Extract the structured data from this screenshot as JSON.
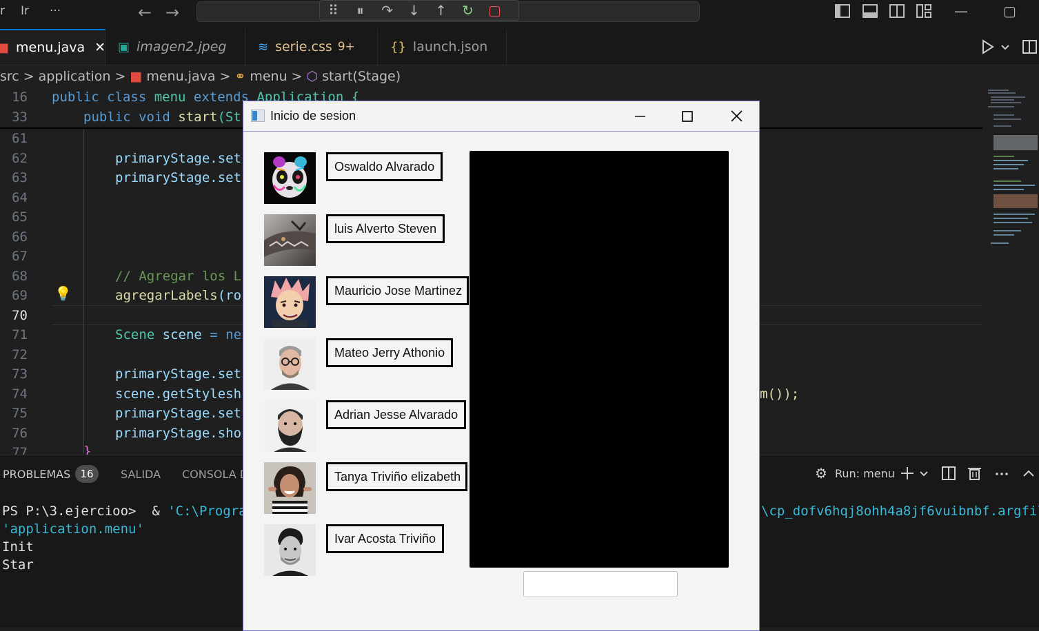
{
  "titlebar": {
    "menu_left_1": "r",
    "menu_left_2": "Ir",
    "more": "···",
    "back": "←",
    "forward": "→"
  },
  "debug_toolbar": {
    "grip": "⠿",
    "pause": "⏸",
    "step_over": "↷",
    "step_into": "↓",
    "step_out": "↑",
    "restart": "↻",
    "stop": "▢",
    "dropdown": "⌄"
  },
  "window_controls": {
    "minimize": "—",
    "maximize": "▢"
  },
  "tabs": [
    {
      "label": "menu.java",
      "icon": "java-icon",
      "close": "✕",
      "active": true
    },
    {
      "label": "imagen2.jpeg",
      "icon": "image-icon"
    },
    {
      "label": "serie.css",
      "badge": "9+",
      "icon": "css-icon"
    },
    {
      "label": "launch.json",
      "icon": "json-icon",
      "icon_text": "{}"
    }
  ],
  "breadcrumb": {
    "src": "src",
    "application": "application",
    "file": "menu.java",
    "class": "menu",
    "method": "start(Stage)",
    "sep": ">"
  },
  "editor": {
    "line_numbers": [
      "16",
      "33",
      "61",
      "62",
      "63",
      "64",
      "65",
      "66",
      "67",
      "68",
      "69",
      "70",
      "71",
      "72",
      "73",
      "74",
      "75",
      "76",
      "77"
    ],
    "lines": {
      "l16_a": "public class ",
      "l16_b": "menu ",
      "l16_c": "extends ",
      "l16_d": "Application {",
      "l33_a": "public void ",
      "l33_b": "start",
      "l33_c": "(St",
      "l62": "primaryStage.set",
      "l63": "primaryStage.set",
      "l68": "// Agregar los L",
      "l69_a": "agregarLabels",
      "l69_b": "(ro",
      "l71_a": "Scene ",
      "l71_b": "scene ",
      "l71_c": "= ne",
      "l73": "primaryStage.set",
      "l74": "scene.getStylesh",
      "l74_tail": "m());",
      "l75": "primaryStage.set",
      "l76": "primaryStage.sho",
      "l77": "}"
    }
  },
  "panel": {
    "tabs": {
      "problems": "PROBLEMAS",
      "problems_count": "16",
      "output": "SALIDA",
      "console": "CONSOLA D"
    },
    "run_label": "Run: menu",
    "terminal": {
      "prompt": "PS P:\\3.ejercioo>  & ",
      "path": "'C:\\Program",
      "path_tail": "\\cp_dofv6hqj8ohh4a8jf6vuibnbf.argfile",
      "arg": "'application.menu'",
      "out1": "Init",
      "out2": "Star"
    }
  },
  "dialog": {
    "title": "Inicio de sesion",
    "people": [
      {
        "name": "Oswaldo Alvarado",
        "image": "panda-art"
      },
      {
        "name": "luis Alverto Steven",
        "image": "dragon"
      },
      {
        "name": "Mauricio Jose Martinez",
        "image": "anime-character"
      },
      {
        "name": "Mateo Jerry Athonio",
        "image": "man-glasses"
      },
      {
        "name": "Adrian Jesse Alvarado",
        "image": "bearded-man"
      },
      {
        "name": "Tanya Triviño elizabeth",
        "image": "woman-smiling"
      },
      {
        "name": "Ivar Acosta Triviño",
        "image": "man-portrait"
      }
    ],
    "input_value": ""
  },
  "colors": {
    "accent": "#0078d4",
    "editor_bg": "#1f1f1f",
    "panel_bg": "#181818",
    "dialog_bg": "#f4f4f4"
  }
}
